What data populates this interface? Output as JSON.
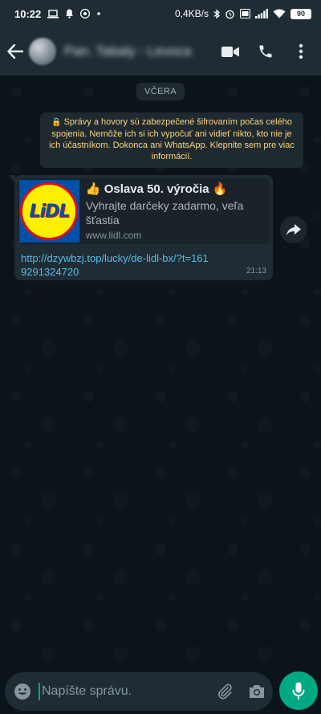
{
  "status_bar": {
    "time": "10:22",
    "network_speed": "0,4KB/s",
    "battery": "90"
  },
  "header": {
    "contact_name": "Pan. Tabaly - Levoca"
  },
  "chat": {
    "date_chip": "VČERA",
    "encryption_notice": "Správy a hovory sú zabezpečené šifrovaním počas celého spojenia. Nemôže ich si ich vypočuť ani vidieť nikto, kto nie je ich účastníkom. Dokonca ani WhatsApp. Klepnite sem pre viac informácií.",
    "message": {
      "preview_title": "👍 Oslava 50. výročia 🔥",
      "preview_description": "Vyhrajte darčeky zadarmo, veľa šťastia",
      "preview_domain": "www.lidl.com",
      "logo_text": "LiDL",
      "link": "http://dzywbzj.top/lucky/de-lidl-bx/?t=1619291324720",
      "time": "21:13"
    }
  },
  "input": {
    "placeholder": "Napíšte správu."
  },
  "colors": {
    "accent": "#00a884",
    "link": "#53bdeb",
    "notice_text": "#ffd279",
    "bubble": "#1f2c34"
  }
}
